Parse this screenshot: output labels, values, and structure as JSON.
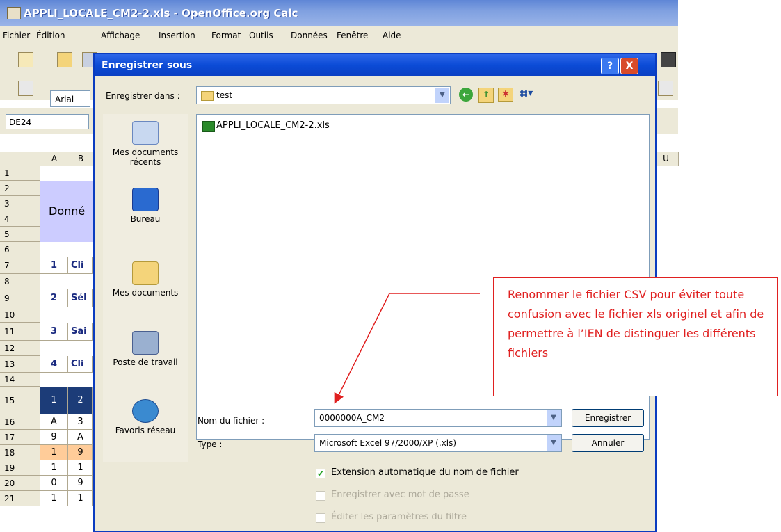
{
  "calc": {
    "title": "APPLI_LOCALE_CM2-2.xls - OpenOffice.org Calc",
    "menu": [
      "Fichier",
      "Édition",
      "Affichage",
      "Insertion",
      "Format",
      "Outils",
      "Données",
      "Fenêtre",
      "Aide"
    ],
    "font_name": "Arial",
    "name_box": "DE24",
    "columns": [
      "A",
      "B",
      "U"
    ],
    "rows": [
      "1",
      "2",
      "3",
      "4",
      "5",
      "6",
      "7",
      "8",
      "9",
      "10",
      "11",
      "12",
      "13",
      "14",
      "15",
      "16",
      "17",
      "18",
      "19",
      "20",
      "21"
    ],
    "visible_cells": {
      "donne": "Donné",
      "step1": "1",
      "step1_text": "Cli",
      "step2": "2",
      "step2_text": "Sél",
      "step3": "3",
      "step3_text": "Sai",
      "step4": "4",
      "step4_text": "Cli",
      "r15a": "1",
      "r15b": "2",
      "r16a": "A",
      "r16b": "3",
      "r17a": "9",
      "r17b": "A",
      "r18a": "1",
      "r18b": "9",
      "r19a": "1",
      "r19b": "1",
      "r20a": "0",
      "r20b": "9",
      "r21a": "1",
      "r21b": "1"
    }
  },
  "dialog": {
    "title": "Enregistrer sous",
    "help_label": "?",
    "close_label": "X",
    "save_in_label": "Enregistrer dans :",
    "save_in_value": "test",
    "places": [
      "Mes documents récents",
      "Bureau",
      "Mes documents",
      "Poste de travail",
      "Favoris réseau"
    ],
    "files": [
      "APPLI_LOCALE_CM2-2.xls"
    ],
    "filename_label": "Nom du fichier :",
    "filename_value": "0000000A_CM2",
    "type_label": "Type :",
    "type_value": "Microsoft Excel 97/2000/XP (.xls)",
    "save_button": "Enregistrer",
    "cancel_button": "Annuler",
    "options": [
      {
        "label": "Extension automatique du nom de fichier",
        "checked": true,
        "enabled": true
      },
      {
        "label": "Enregistrer avec mot de passe",
        "checked": false,
        "enabled": false
      },
      {
        "label": "Éditer les paramètres du filtre",
        "checked": false,
        "enabled": false
      }
    ]
  },
  "callout": {
    "text": "Renommer le fichier CSV pour éviter toute confusion avec le fichier xls originel et afin de permettre à l’IEN de distinguer les différents fichiers",
    "color": "#e02020"
  }
}
